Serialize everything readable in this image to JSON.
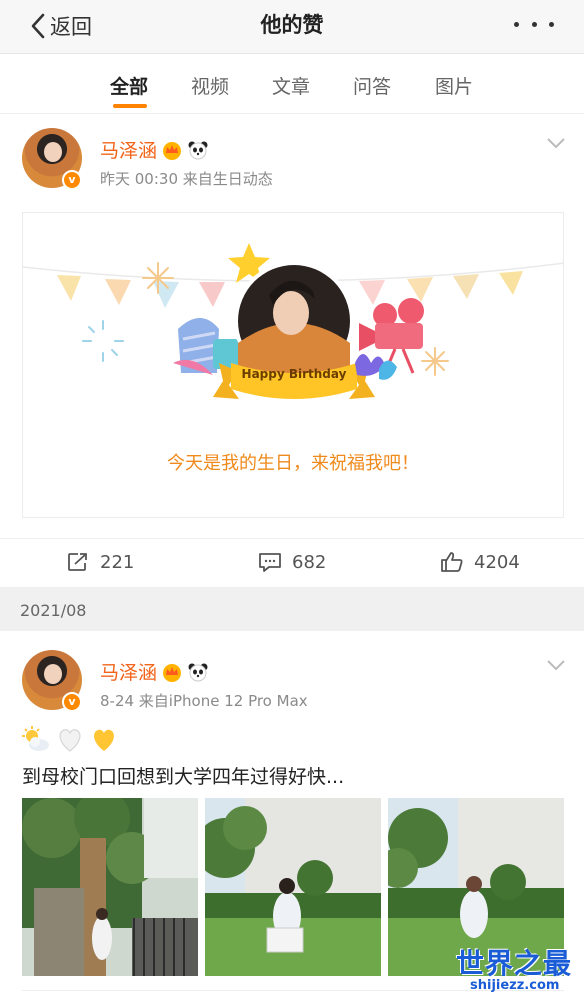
{
  "nav": {
    "back_label": "返回",
    "title": "他的赞"
  },
  "tabs": [
    {
      "label": "全部",
      "active": true
    },
    {
      "label": "视频",
      "active": false
    },
    {
      "label": "文章",
      "active": false
    },
    {
      "label": "问答",
      "active": false
    },
    {
      "label": "图片",
      "active": false
    }
  ],
  "accent_color": "#ff8200",
  "posts": [
    {
      "username": "马泽涵",
      "meta": "昨天 00:30  来自生日动态",
      "birthday_card": {
        "banner_text": "Happy Birthday",
        "message": "今天是我的生日，来祝福我吧！"
      },
      "actions": {
        "repost": "221",
        "comment": "682",
        "like": "4204"
      }
    },
    {
      "username": "马泽涵",
      "meta": "8-24  来自iPhone 12 Pro Max",
      "text": "到母校门口回想到大学四年过得好快...",
      "emoji_icons": [
        "sun-cloud-icon",
        "white-heart-icon",
        "yellow-heart-icon"
      ]
    }
  ],
  "date_separator": "2021/08",
  "watermark": {
    "main": "世界之最",
    "sub": "shijiezz.com"
  }
}
